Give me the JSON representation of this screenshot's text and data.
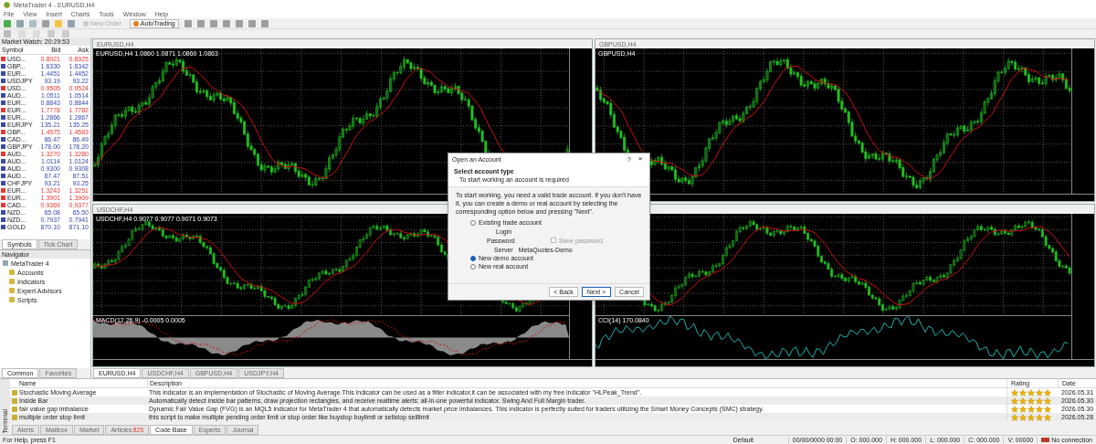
{
  "window": {
    "title": "MetaTrader 4 - EURUSD,H4"
  },
  "menu": [
    "File",
    "View",
    "Insert",
    "Charts",
    "Tools",
    "Window",
    "Help"
  ],
  "toolbar": {
    "buttons": [
      {
        "label": "New Order",
        "disabled": true
      },
      {
        "label": "AutoTrading",
        "disabled": false
      }
    ]
  },
  "market_watch": {
    "title": "Market Watch: 20:29:53",
    "columns": [
      "Symbol",
      "Bid",
      "Ask"
    ],
    "rows": [
      {
        "symbol": "USD...",
        "bid": "0.8921",
        "ask": "0.8925",
        "color": "#e53935"
      },
      {
        "symbol": "GBP...",
        "bid": "1.6330",
        "ask": "1.6342",
        "color": "#3949ab"
      },
      {
        "symbol": "EUR...",
        "bid": "1.4451",
        "ask": "1.4452",
        "color": "#3949ab"
      },
      {
        "symbol": "USDJPY",
        "bid": "93.19",
        "ask": "93.22",
        "color": "#3949ab"
      },
      {
        "symbol": "USD...",
        "bid": "0.9505",
        "ask": "0.9524",
        "color": "#e53935"
      },
      {
        "symbol": "AUD...",
        "bid": "1.0511",
        "ask": "1.0514",
        "color": "#3949ab"
      },
      {
        "symbol": "EUR...",
        "bid": "0.8843",
        "ask": "0.8844",
        "color": "#3949ab"
      },
      {
        "symbol": "EUR...",
        "bid": "1.7778",
        "ask": "1.7782",
        "color": "#e53935"
      },
      {
        "symbol": "EUR...",
        "bid": "1.2866",
        "ask": "1.2867",
        "color": "#3949ab"
      },
      {
        "symbol": "EURJPY",
        "bid": "135.21",
        "ask": "135.25",
        "color": "#3949ab"
      },
      {
        "symbol": "GBP...",
        "bid": "1.4575",
        "ask": "1.4583",
        "color": "#e53935"
      },
      {
        "symbol": "CAD...",
        "bid": "86.47",
        "ask": "86.49",
        "color": "#3949ab"
      },
      {
        "symbol": "GBPJPY",
        "bid": "178.00",
        "ask": "178.20",
        "color": "#3949ab"
      },
      {
        "symbol": "AUD...",
        "bid": "1.3270",
        "ask": "1.3280",
        "color": "#e53935"
      },
      {
        "symbol": "AUD...",
        "bid": "1.0114",
        "ask": "1.0124",
        "color": "#3949ab"
      },
      {
        "symbol": "AUD...",
        "bid": "0.9300",
        "ask": "0.9308",
        "color": "#3949ab"
      },
      {
        "symbol": "AUD...",
        "bid": "87.47",
        "ask": "87.51",
        "color": "#3949ab"
      },
      {
        "symbol": "CHFJPY",
        "bid": "93.21",
        "ask": "93.25",
        "color": "#3949ab"
      },
      {
        "symbol": "EUR...",
        "bid": "1.3243",
        "ask": "1.3251",
        "color": "#e53935"
      },
      {
        "symbol": "EUR...",
        "bid": "1.3901",
        "ask": "1.3909",
        "color": "#e53935"
      },
      {
        "symbol": "CAD...",
        "bid": "0.9369",
        "ask": "0.9377",
        "color": "#e53935"
      },
      {
        "symbol": "NZD...",
        "bid": "65.08",
        "ask": "65.50",
        "color": "#3949ab"
      },
      {
        "symbol": "NZD...",
        "bid": "0.7937",
        "ask": "0.7941",
        "color": "#3949ab"
      },
      {
        "symbol": "GOLD",
        "bid": "870.10",
        "ask": "871.10",
        "color": "#3949ab"
      }
    ],
    "tabs": [
      {
        "label": "Symbols",
        "selected": true
      },
      {
        "label": "Tick Chart",
        "selected": false
      }
    ]
  },
  "navigator": {
    "title": "Navigator",
    "root": {
      "label": "MetaTrader 4",
      "children": [
        {
          "label": "Accounts"
        },
        {
          "label": "Indicators"
        },
        {
          "label": "Expert Advisors"
        },
        {
          "label": "Scripts"
        }
      ]
    },
    "tabs": [
      {
        "label": "Common",
        "selected": true
      },
      {
        "label": "Favorites",
        "selected": false
      }
    ]
  },
  "charts": [
    {
      "title": "EURUSD,H4",
      "header": "EURUSD,H4 1.0860 1.0871 1.0860 1.0863"
    },
    {
      "title": "GBPUSD,H4",
      "header": "GBPUSD,H4"
    },
    {
      "title": "USDCHF,H4",
      "header": "USDCHF,H4 0.9077 0.9077 0.9071 0.9073",
      "subwindow": {
        "kind": "macd",
        "label": "MACD(12,26,9) -0.0005 0.0005"
      }
    },
    {
      "subwindow": {
        "kind": "cci",
        "label": "CCI(14) 170.0840"
      }
    }
  ],
  "chart_tabs": [
    {
      "label": "EURUSD,H4",
      "selected": true
    },
    {
      "label": "USDCHF,H4",
      "selected": false
    },
    {
      "label": "GBPUSD,H4",
      "selected": false
    },
    {
      "label": "USDJPY,H4",
      "selected": false
    }
  ],
  "dialog": {
    "title": "Open an Account",
    "help": "?",
    "close": "×",
    "heading": "Select account type",
    "subheading": "To start working an account is required",
    "text": "To start working, you need a valid trade account. If you don't have it, you can create a demo or real account by selecting the corresponding option below and pressing \"Next\".",
    "options": [
      {
        "label": "Existing trade account",
        "selected": false
      },
      {
        "label": "New demo account",
        "selected": true
      },
      {
        "label": "New real account",
        "selected": false
      }
    ],
    "login_label": "Login",
    "password_label": "Password",
    "save_password": {
      "label": "Save password",
      "checked": false,
      "disabled": true
    },
    "server_label": "Server",
    "server": "MetaQuotes-Demo",
    "buttons": [
      {
        "label": "< Back",
        "default": false
      },
      {
        "label": "Next >",
        "default": true
      },
      {
        "label": "Cancel",
        "default": false
      }
    ]
  },
  "terminal": {
    "side_label": "Terminal",
    "columns": [
      "Name",
      "Description",
      "Rating",
      "Date"
    ],
    "rows": [
      {
        "name": "Stochastic Moving Average",
        "description": "This indicator is an implementation of Stochastic of Moving Average.This indicator can be used as a filter indicator,it can be associated with my free indicator \"HLPeak_Trend\".",
        "stars": 5,
        "date": "2026.05.31"
      },
      {
        "name": "Inside Bar",
        "description": "Automatically detect inside bar patterns, draw projection rectangles, and receive realtime alerts: all-in-one powerful indicator. Swing And Full Margin trader.",
        "stars": 5,
        "date": "2026.05.30"
      },
      {
        "name": "fair value gap imbalance",
        "description": "Dynamic Fair Value Gap (FVG) is an MQL5 indicator for MetaTrader 4 that automatically detects market price imbalances. This indicator is perfectly suited for traders utilizing the Smart Money Concepts (SMC) strategy.",
        "stars": 5,
        "date": "2026.05.30"
      },
      {
        "name": "multiple order stop limit",
        "description": "this script to make multiple pending order limit or stop order like buystop buylimit or sellstop selllimit",
        "stars": 5,
        "date": "2026.05.28"
      }
    ],
    "tabs": [
      {
        "label": "Alerts",
        "selected": false
      },
      {
        "label": "Mailbox",
        "selected": false
      },
      {
        "label": "Market",
        "selected": false
      },
      {
        "label": "Articles",
        "selected": false,
        "badge": "825"
      },
      {
        "label": "Code Base",
        "selected": true
      },
      {
        "label": "Experts",
        "selected": false
      },
      {
        "label": "Journal",
        "selected": false
      }
    ]
  },
  "status_bar": {
    "help": "For Help, press F1",
    "profile": "Default",
    "fields": [
      "00/00/0000 00:00",
      "O: 000.000",
      "H: 000.000",
      "L: 000.000",
      "C: 000.000",
      "V: 00000"
    ],
    "connection": "No connection"
  }
}
